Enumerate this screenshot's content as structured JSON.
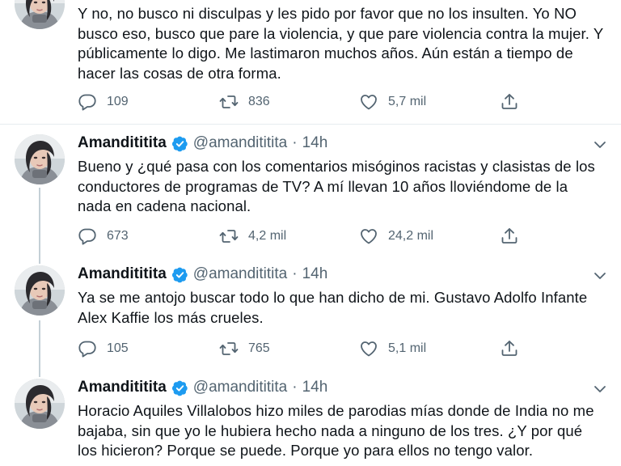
{
  "accent_color": "#1d9bf0",
  "tweets": [
    {
      "text": "Y no, no busco ni disculpas y les pido por favor que no los insulten. Yo NO busco eso, busco que pare la violencia, y que pare violencia contra la mujer. Y públicamente lo digo. Me lastimaron muchos años. Aún están a tiempo de hacer las cosas de otra forma.",
      "replies": "109",
      "retweets": "836",
      "likes": "5,7 mil"
    },
    {
      "name": "Amandititita",
      "handle": "@amandititita",
      "dot": "·",
      "time": "14h",
      "text": "Bueno y ¿qué pasa con los comentarios misóginos racistas y clasistas de los conductores de programas de TV? A mí llevan 10 años lloviéndome de la nada en cadena nacional.",
      "replies": "673",
      "retweets": "4,2 mil",
      "likes": "24,2 mil"
    },
    {
      "name": "Amandititita",
      "handle": "@amandititita",
      "dot": "·",
      "time": "14h",
      "text": "Ya se me antojo buscar todo lo que han dicho de mi. Gustavo Adolfo Infante Alex Kaffie los más crueles.",
      "replies": "105",
      "retweets": "765",
      "likes": "5,1 mil"
    },
    {
      "name": "Amandititita",
      "handle": "@amandititita",
      "dot": "·",
      "time": "14h",
      "text": "Horacio Aquiles Villalobos hizo miles de parodias mías donde de India no me bajaba, sin que yo le hubiera hecho nada a ninguno de los tres. ¿Y por qué los hicieron? Porque se puede. Porque yo para ellos no tengo valor."
    }
  ]
}
